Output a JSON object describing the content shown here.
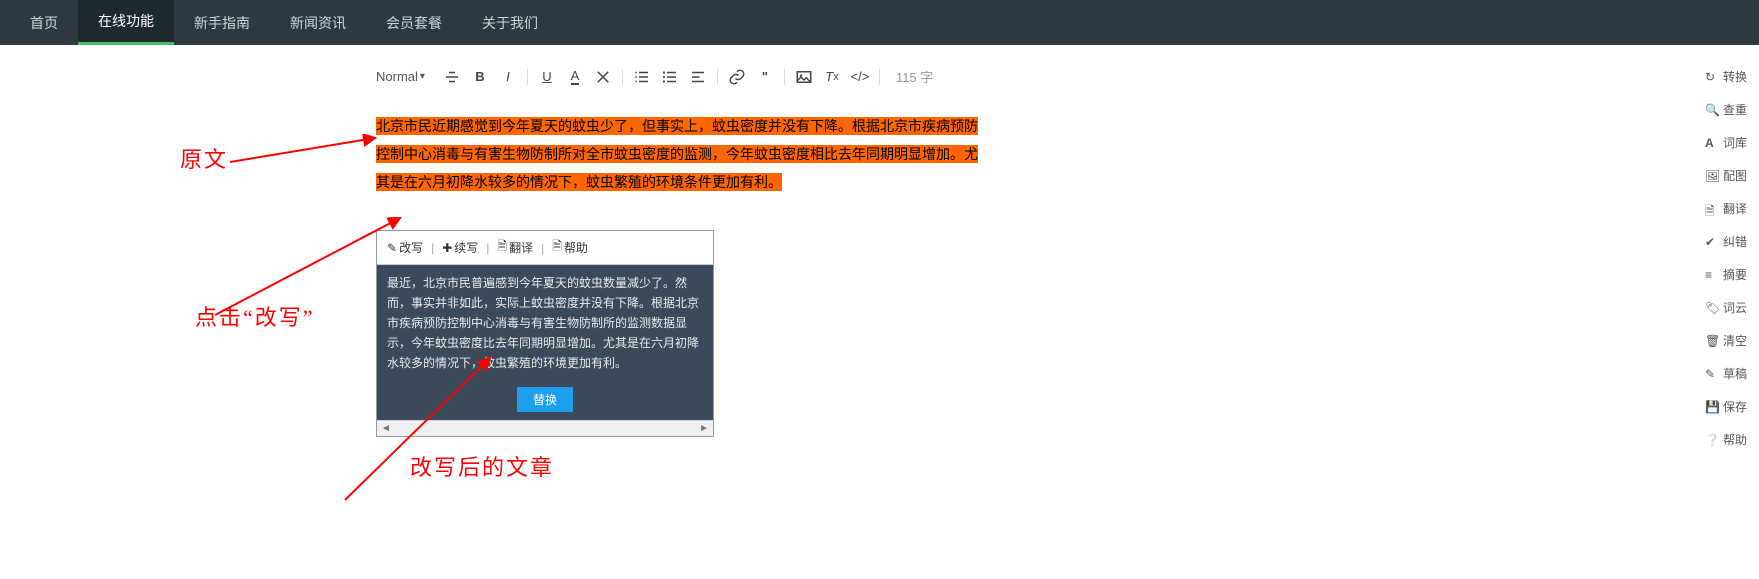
{
  "nav": {
    "items": [
      {
        "label": "首页"
      },
      {
        "label": "在线功能"
      },
      {
        "label": "新手指南"
      },
      {
        "label": "新闻资讯"
      },
      {
        "label": "会员套餐"
      },
      {
        "label": "关于我们"
      }
    ],
    "active_index": 1
  },
  "toolbar": {
    "style_label": "Normal",
    "wordcount_label": "115 字"
  },
  "original_text": "北京市民近期感觉到今年夏天的蚊虫少了，但事实上，蚊虫密度并没有下降。根据北京市疾病预防控制中心消毒与有害生物防制所对全市蚊虫密度的监测，今年蚊虫密度相比去年同期明显增加。尤其是在六月初降水较多的情况下，蚊虫繁殖的环境条件更加有利。",
  "popup": {
    "actions": {
      "rewrite": "改写",
      "continue": "续写",
      "translate": "翻译",
      "help": "帮助"
    },
    "rewritten_text": "最近，北京市民普遍感到今年夏天的蚊虫数量减少了。然而，事实并非如此，实际上蚊虫密度并没有下降。根据北京市疾病预防控制中心消毒与有害生物防制所的监测数据显示，今年蚊虫密度比去年同期明显增加。尤其是在六月初降水较多的情况下，蚊虫繁殖的环境更加有利。",
    "replace_button": "替换"
  },
  "sidebar": {
    "items": [
      {
        "label": "转换"
      },
      {
        "label": "查重"
      },
      {
        "label": "词库"
      },
      {
        "label": "配图"
      },
      {
        "label": "翻译"
      },
      {
        "label": "纠错"
      },
      {
        "label": "摘要"
      },
      {
        "label": "词云"
      },
      {
        "label": "清空"
      },
      {
        "label": "草稿"
      },
      {
        "label": "保存"
      },
      {
        "label": "帮助"
      }
    ]
  },
  "annot": {
    "label1": "原文",
    "label2": "点击“改写”",
    "label3": "改写后的文章"
  }
}
